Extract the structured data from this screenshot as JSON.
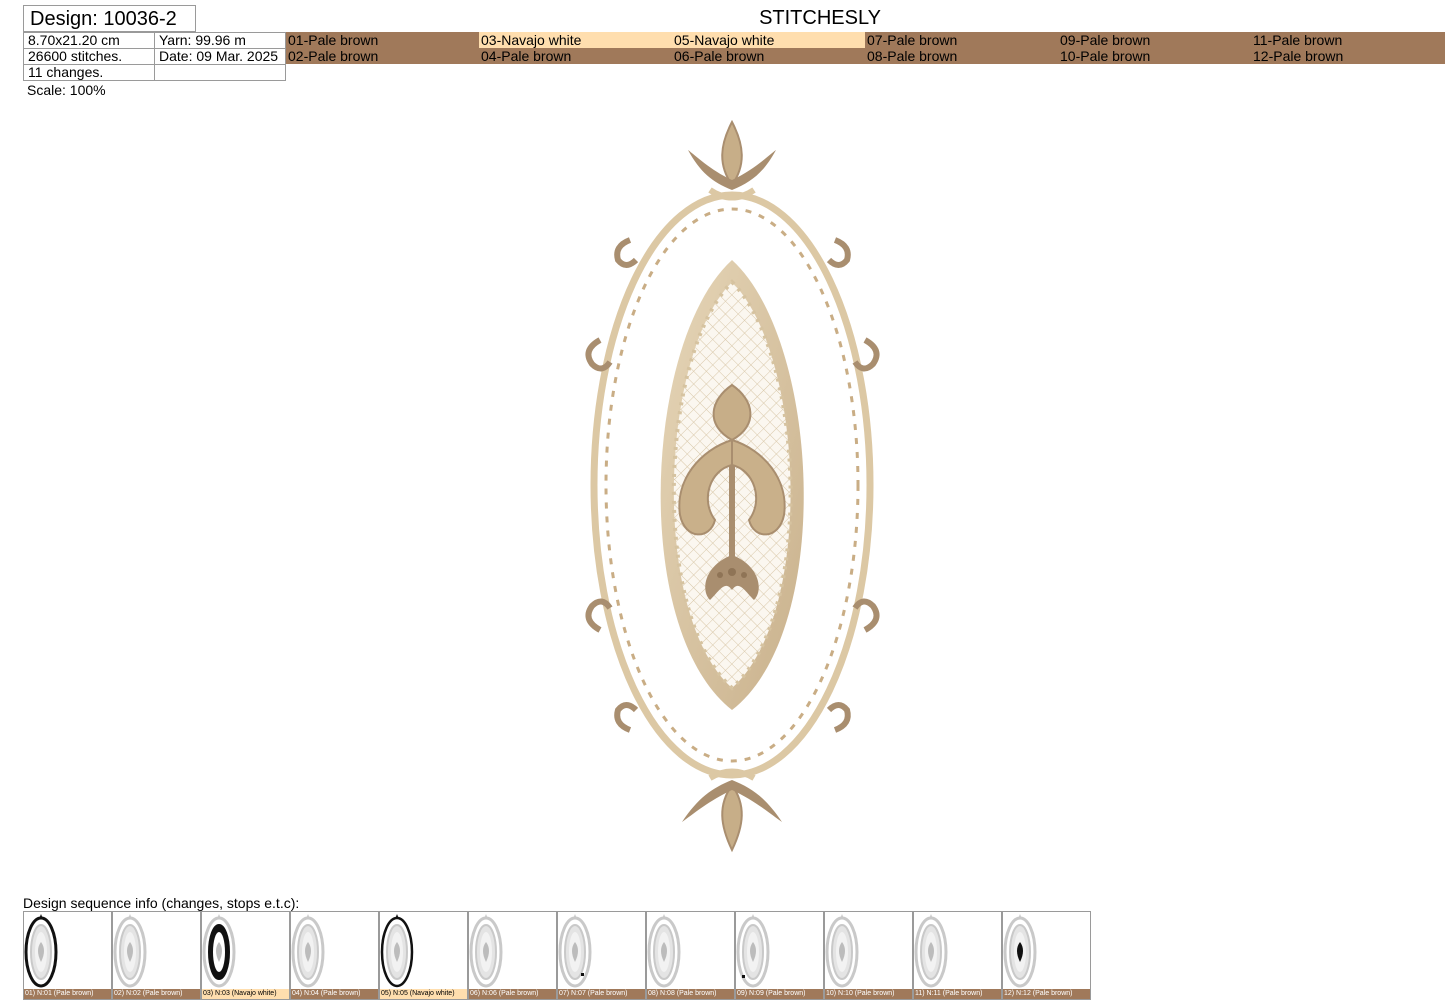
{
  "header": {
    "design_title": "Design: 10036-2",
    "brand": "STITCHESLY",
    "size": "8.70x21.20 cm",
    "yarn": "Yarn: 99.96 m",
    "stitches": "26600 stitches.",
    "date": "Date: 09 Mar. 2025",
    "changes": "11 changes.",
    "scale": "Scale: 100%"
  },
  "colors": {
    "pale_brown": "#a0795a",
    "navajo_white": "#ffdeae",
    "thread_light": "#dcc8a4",
    "thread_dark": "#a98e6f"
  },
  "threads": [
    {
      "label": "01-Pale brown",
      "color": "pale_brown"
    },
    {
      "label": "02-Pale brown",
      "color": "pale_brown"
    },
    {
      "label": "03-Navajo white",
      "color": "navajo_white"
    },
    {
      "label": "04-Pale brown",
      "color": "pale_brown"
    },
    {
      "label": "05-Navajo white",
      "color": "navajo_white"
    },
    {
      "label": "06-Pale brown",
      "color": "pale_brown"
    },
    {
      "label": "07-Pale brown",
      "color": "pale_brown"
    },
    {
      "label": "08-Pale brown",
      "color": "pale_brown"
    },
    {
      "label": "09-Pale brown",
      "color": "pale_brown"
    },
    {
      "label": "10-Pale brown",
      "color": "pale_brown"
    },
    {
      "label": "11-Pale brown",
      "color": "pale_brown"
    },
    {
      "label": "12-Pale brown",
      "color": "pale_brown"
    }
  ],
  "sequence": {
    "title": "Design sequence info (changes, stops e.t.c):",
    "steps": [
      {
        "caption": "01) N:01 (Pale brown)",
        "color": "pale_brown",
        "highlight": "outline"
      },
      {
        "caption": "02) N:02 (Pale brown)",
        "color": "pale_brown",
        "highlight": "none"
      },
      {
        "caption": "03) N:03 (Navajo white)",
        "color": "navajo_white",
        "highlight": "ring"
      },
      {
        "caption": "04) N:04 (Pale brown)",
        "color": "pale_brown",
        "highlight": "none"
      },
      {
        "caption": "05) N:05 (Navajo white)",
        "color": "navajo_white",
        "highlight": "frame"
      },
      {
        "caption": "06) N:06 (Pale brown)",
        "color": "pale_brown",
        "highlight": "none"
      },
      {
        "caption": "07) N:07 (Pale brown)",
        "color": "pale_brown",
        "highlight": "dot-right"
      },
      {
        "caption": "08) N:08 (Pale brown)",
        "color": "pale_brown",
        "highlight": "none"
      },
      {
        "caption": "09) N:09 (Pale brown)",
        "color": "pale_brown",
        "highlight": "dot-left"
      },
      {
        "caption": "10) N:10 (Pale brown)",
        "color": "pale_brown",
        "highlight": "none"
      },
      {
        "caption": "11) N:11 (Pale brown)",
        "color": "pale_brown",
        "highlight": "none"
      },
      {
        "caption": "12) N:12 (Pale brown)",
        "color": "pale_brown",
        "highlight": "center"
      }
    ]
  }
}
